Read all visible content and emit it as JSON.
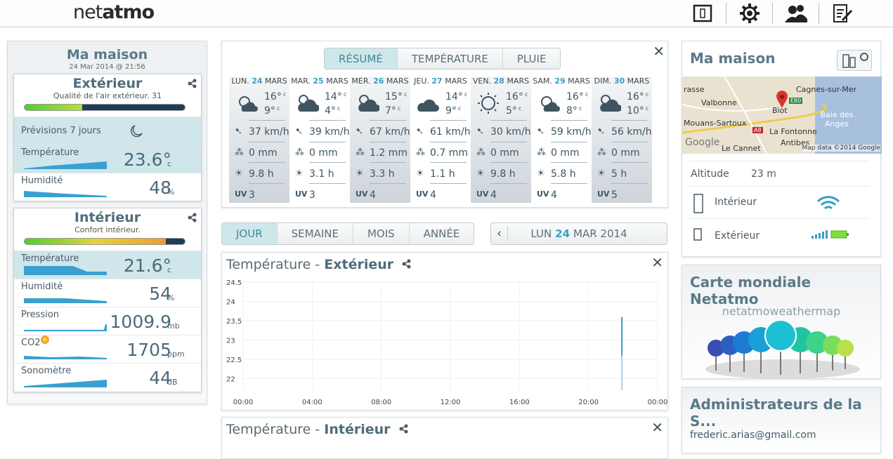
{
  "header": {
    "logo_light": "net",
    "logo_bold": "atmo",
    "icons": [
      "module-icon",
      "gear-icon",
      "users-icon",
      "edit-icon"
    ]
  },
  "left": {
    "title": "Ma maison",
    "date": "24 Mar 2014 @ 21:56",
    "exterieur": {
      "title": "Extérieur",
      "subtitle": "Qualité de l'air extérieur. 31",
      "quality_level": 0.36,
      "forecast_label": "Prévisions 7 jours",
      "rows": [
        {
          "label": "Température",
          "value": "23.6°",
          "unit": "c"
        },
        {
          "label": "Humidité",
          "value": "48",
          "unit": "%"
        }
      ]
    },
    "interieur": {
      "title": "Intérieur",
      "subtitle": "Confort intérieur.",
      "comfort_level": 0.88,
      "rows": [
        {
          "label": "Température",
          "value": "21.6°",
          "unit": "c"
        },
        {
          "label": "Humidité",
          "value": "54",
          "unit": "%"
        },
        {
          "label": "Pression",
          "value": "1009.9",
          "unit": "mb"
        },
        {
          "label": "CO2",
          "value": "1705",
          "unit": "ppm"
        },
        {
          "label": "Sonomètre",
          "value": "44",
          "unit": "dB"
        }
      ]
    }
  },
  "forecast": {
    "tabs": [
      "RÉSUMÉ",
      "TEMPÉRATURE",
      "PLUIE"
    ],
    "active_tab": 0,
    "unit": "c",
    "days": [
      {
        "name": "LUN.",
        "num": "24",
        "month": "MARS",
        "hi": "16°",
        "lo": "9°",
        "wind": "37 km/h",
        "rain": "0 mm",
        "sun": "9.8 h",
        "uv": "3",
        "icon": "partly-cloudy-icon"
      },
      {
        "name": "MAR.",
        "num": "25",
        "month": "MARS",
        "hi": "14°",
        "lo": "4°",
        "wind": "39 km/h",
        "rain": "0 mm",
        "sun": "3.1 h",
        "uv": "3",
        "icon": "cloudy-sun-icon"
      },
      {
        "name": "MER.",
        "num": "26",
        "month": "MARS",
        "hi": "15°",
        "lo": "7°",
        "wind": "67 km/h",
        "rain": "1.2 mm",
        "sun": "3.3 h",
        "uv": "4",
        "icon": "cloudy-sun-icon"
      },
      {
        "name": "JEU.",
        "num": "27",
        "month": "MARS",
        "hi": "14°",
        "lo": "9°",
        "wind": "61 km/h",
        "rain": "0.7 mm",
        "sun": "1.1 h",
        "uv": "4",
        "icon": "cloud-icon"
      },
      {
        "name": "VEN.",
        "num": "28",
        "month": "MARS",
        "hi": "16°",
        "lo": "5°",
        "wind": "30 km/h",
        "rain": "0 mm",
        "sun": "9.8 h",
        "uv": "4",
        "icon": "sun-icon"
      },
      {
        "name": "SAM.",
        "num": "29",
        "month": "MARS",
        "hi": "16°",
        "lo": "8°",
        "wind": "59 km/h",
        "rain": "0 mm",
        "sun": "5.8 h",
        "uv": "4",
        "icon": "partly-cloudy-icon"
      },
      {
        "name": "DIM.",
        "num": "30",
        "month": "MARS",
        "hi": "16°",
        "lo": "10°",
        "wind": "56 km/h",
        "rain": "0 mm",
        "sun": "5 h",
        "uv": "5",
        "icon": "cloudy-sun-icon"
      }
    ]
  },
  "range_tabs": [
    "JOUR",
    "SEMAINE",
    "MOIS",
    "ANNÉE"
  ],
  "range_active": 0,
  "date_nav": {
    "day": "LUN",
    "num": "24",
    "rest": "MAR 2014"
  },
  "chart_ext": {
    "title_prefix": "Température - ",
    "title_bold": "Extérieur"
  },
  "chart_int": {
    "title_prefix": "Température - ",
    "title_bold": "Intérieur"
  },
  "chart_data": {
    "type": "line",
    "yticks": [
      "24.5",
      "24",
      "23.5",
      "23",
      "22.5",
      "22"
    ],
    "xticks": [
      "00:00",
      "04:00",
      "08:00",
      "12:00",
      "16:00",
      "20:00",
      "00:00"
    ],
    "ylim": [
      21.7,
      24.5
    ],
    "series": [
      {
        "values": [
          [
            21.93,
            22.6
          ],
          [
            21.93,
            23.6
          ]
        ]
      }
    ]
  },
  "right": {
    "house_title": "Ma maison",
    "map_labels": [
      "rasse",
      "Cagnes-sur-Mer",
      "Valbonne",
      "Biot",
      "E80",
      "Mouans-Sartoux",
      "Baie des Anges",
      "A8",
      "La Fontonne",
      "Google",
      "Le Cannet",
      "Antibes",
      "Map data ©2014 Google"
    ],
    "altitude_label": "Altitude",
    "altitude_value": "23 m",
    "modules": [
      {
        "label": "Intérieur"
      },
      {
        "label": "Extérieur"
      }
    ],
    "world_title": "Carte mondiale Netatmo",
    "weathermap_logo": "netatmoweathermap",
    "admins_title": "Administrateurs de la S...",
    "admin_email": "frederic.arias@gmail.com",
    "colors": {
      "accent": "#3a9ec4",
      "teal": "#cfe6ea",
      "battery": "#7ddf3c"
    }
  }
}
